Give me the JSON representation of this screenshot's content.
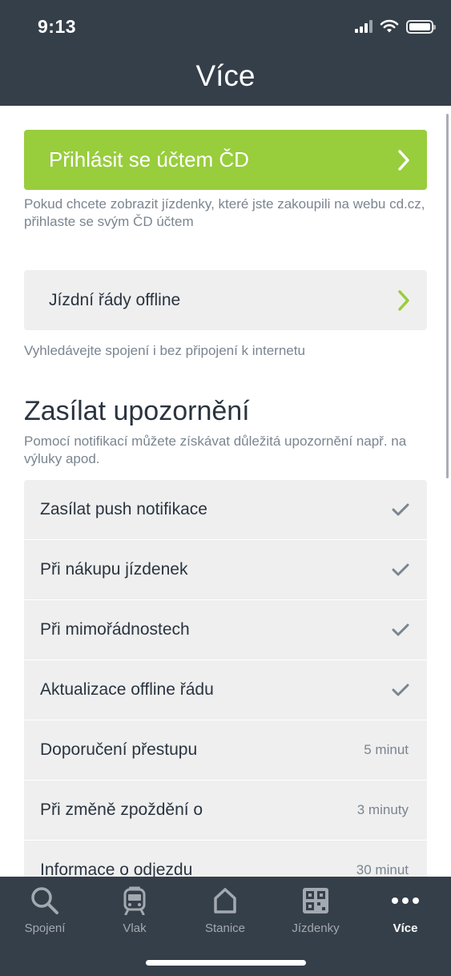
{
  "status_bar": {
    "time": "9:13"
  },
  "header": {
    "title": "Více"
  },
  "login": {
    "button_label": "Přihlásit se účtem ČD",
    "hint": "Pokud chcete zobrazit jízdenky, které jste zakoupili na webu cd.cz, přihlaste se svým ČD účtem"
  },
  "offline": {
    "label": "Jízdní řády offline",
    "hint": "Vyhledávejte spojení i bez připojení k internetu"
  },
  "notifications": {
    "title": "Zasílat upozornění",
    "subtitle": "Pomocí notifikací můžete získávat důležitá upozornění např. na výluky apod.",
    "items": [
      {
        "label": "Zasílat push notifikace",
        "checked": true,
        "value": ""
      },
      {
        "label": "Při nákupu jízdenek",
        "checked": true,
        "value": ""
      },
      {
        "label": "Při mimořádnostech",
        "checked": true,
        "value": ""
      },
      {
        "label": "Aktualizace offline řádu",
        "checked": true,
        "value": ""
      },
      {
        "label": "Doporučení přestupu",
        "checked": false,
        "value": "5 minut"
      },
      {
        "label": "Při změně zpoždění o",
        "checked": false,
        "value": "3 minuty"
      },
      {
        "label": "Informace o odjezdu",
        "checked": false,
        "value": "30 minut"
      }
    ]
  },
  "tabs": [
    {
      "label": "Spojení",
      "icon": "search-icon",
      "active": false
    },
    {
      "label": "Vlak",
      "icon": "train-icon",
      "active": false
    },
    {
      "label": "Stanice",
      "icon": "home-icon",
      "active": false
    },
    {
      "label": "Jízdenky",
      "icon": "qr-code-icon",
      "active": false
    },
    {
      "label": "Více",
      "icon": "more-icon",
      "active": true
    }
  ],
  "colors": {
    "header_bg": "#353f4a",
    "accent_green": "#98cd3c",
    "row_bg": "#efefef",
    "muted_text": "#7a8590"
  }
}
